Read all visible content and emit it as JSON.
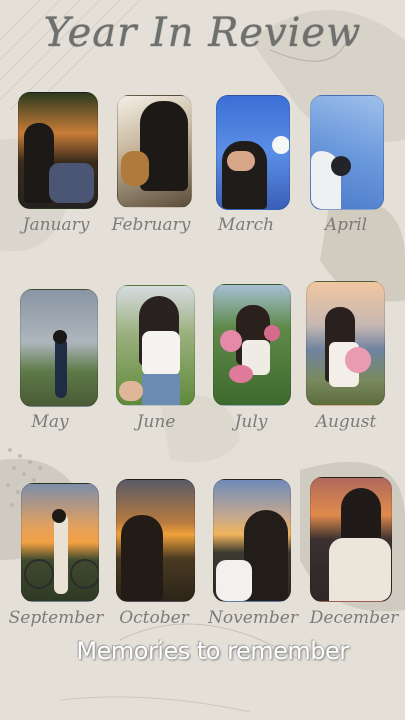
{
  "title": "Year In Review",
  "months": [
    "January",
    "February",
    "March",
    "April",
    "May",
    "June",
    "July",
    "August",
    "September",
    "October",
    "November",
    "December"
  ],
  "tagline": "Memories to remember"
}
